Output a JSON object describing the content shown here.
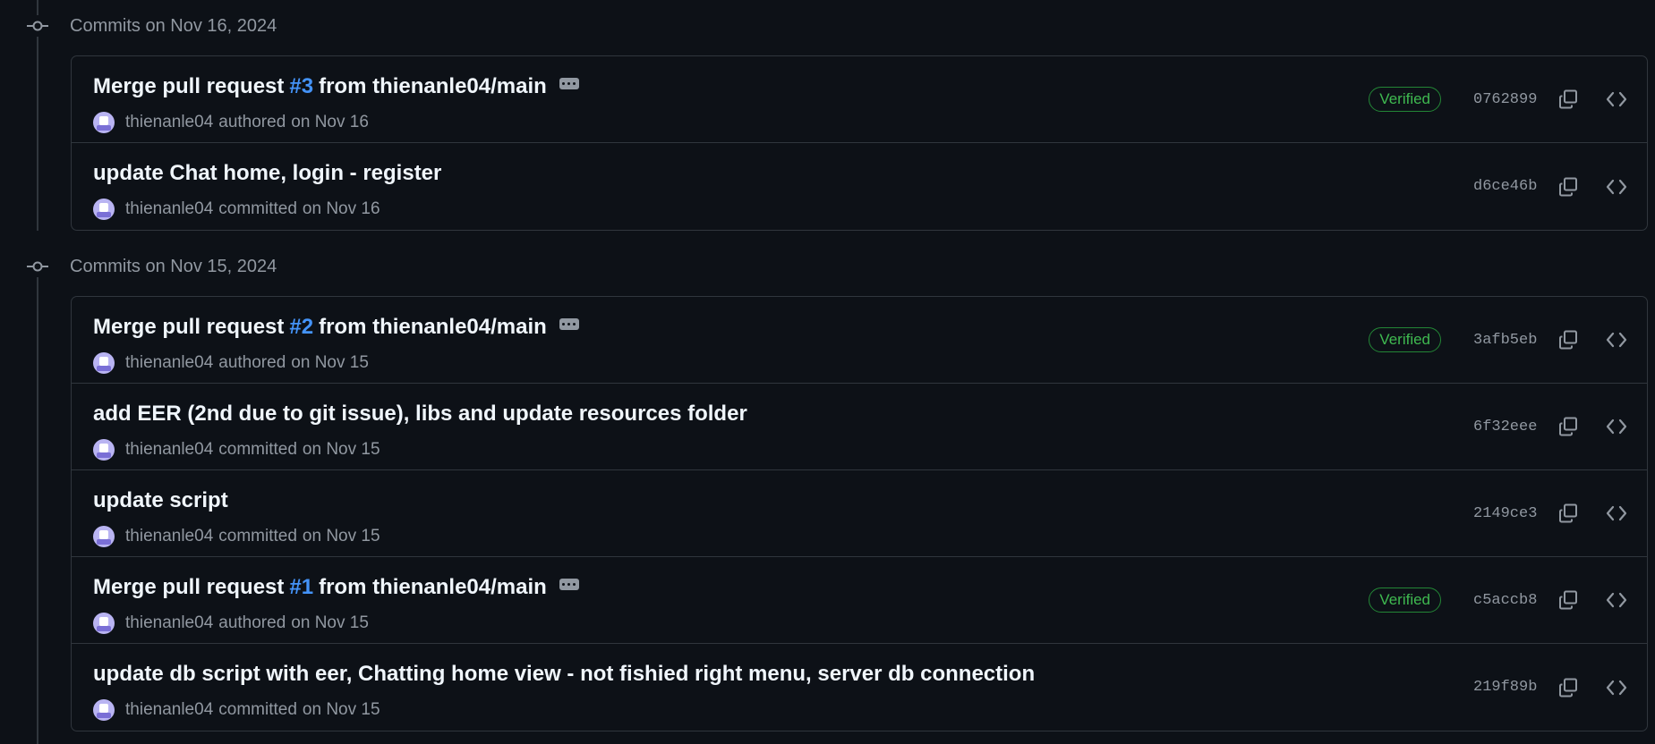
{
  "groups": [
    {
      "date_label": "Commits on Nov 16, 2024",
      "commits": [
        {
          "prefix": "Merge pull request ",
          "pr": "#3",
          "suffix": " from thienanle04/main",
          "has_ellipsis": true,
          "author": "thienanle04",
          "action": "authored",
          "date": "on Nov 16",
          "verified": "Verified",
          "sha": "0762899"
        },
        {
          "prefix": "update Chat home, login - register",
          "pr": "",
          "suffix": "",
          "has_ellipsis": false,
          "author": "thienanle04",
          "action": "committed",
          "date": "on Nov 16",
          "verified": "",
          "sha": "d6ce46b"
        }
      ]
    },
    {
      "date_label": "Commits on Nov 15, 2024",
      "commits": [
        {
          "prefix": "Merge pull request ",
          "pr": "#2",
          "suffix": " from thienanle04/main",
          "has_ellipsis": true,
          "author": "thienanle04",
          "action": "authored",
          "date": "on Nov 15",
          "verified": "Verified",
          "sha": "3afb5eb"
        },
        {
          "prefix": "add EER (2nd due to git issue), libs and update resources folder",
          "pr": "",
          "suffix": "",
          "has_ellipsis": false,
          "author": "thienanle04",
          "action": "committed",
          "date": "on Nov 15",
          "verified": "",
          "sha": "6f32eee"
        },
        {
          "prefix": "update script",
          "pr": "",
          "suffix": "",
          "has_ellipsis": false,
          "author": "thienanle04",
          "action": "committed",
          "date": "on Nov 15",
          "verified": "",
          "sha": "2149ce3"
        },
        {
          "prefix": "Merge pull request ",
          "pr": "#1",
          "suffix": " from thienanle04/main",
          "has_ellipsis": true,
          "author": "thienanle04",
          "action": "authored",
          "date": "on Nov 15",
          "verified": "Verified",
          "sha": "c5accb8"
        },
        {
          "prefix": "update db script with eer, Chatting home view - not fishied right menu, server db connection",
          "pr": "",
          "suffix": "",
          "has_ellipsis": false,
          "author": "thienanle04",
          "action": "committed",
          "date": "on Nov 15",
          "verified": "",
          "sha": "219f89b"
        }
      ]
    }
  ],
  "icons": {
    "commit_node": "git-commit-icon",
    "copy": "copy-icon",
    "browse": "code-icon",
    "avatar": "user-avatar"
  },
  "colors": {
    "background": "#0d1117",
    "border": "#30363d",
    "link": "#4493f8",
    "verified": "#3fb950",
    "muted": "#9198a1"
  }
}
